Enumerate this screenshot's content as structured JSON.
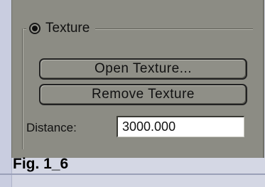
{
  "group": {
    "radio_selected": true,
    "label": "Texture"
  },
  "buttons": {
    "open_texture": "Open Texture...",
    "remove_texture": "Remove Texture"
  },
  "distance": {
    "label": "Distance:",
    "value": "3000.000"
  },
  "caption": "Fig. 1_6"
}
